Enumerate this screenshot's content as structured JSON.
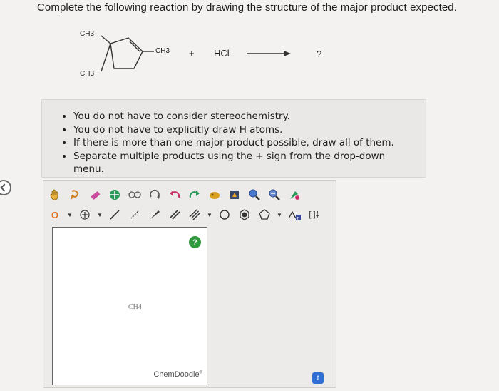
{
  "question": "Complete the following reaction by drawing the structure of the major product expected.",
  "reaction": {
    "substituent_top": "CH3",
    "substituent_bottom": "CH3",
    "substituent_right": "CH3",
    "plus": "+",
    "reagent": "HCl",
    "product": "?"
  },
  "instructions": [
    "You do not have to consider stereochemistry.",
    "You do not have to explicitly draw H atoms.",
    "If there is more than one major product possible, draw all of them.",
    "Separate multiple products using the + sign from the drop-down menu."
  ],
  "editor": {
    "atom_label": "O",
    "canvas_label": "CH4",
    "help": "?",
    "brand": "ChemDoodle",
    "brand_mark": "®",
    "template_label": "n",
    "bracket_label": "[ ]‡"
  },
  "colors": {
    "help_green": "#2e9a3c",
    "scroll_blue": "#2f6fd1"
  }
}
